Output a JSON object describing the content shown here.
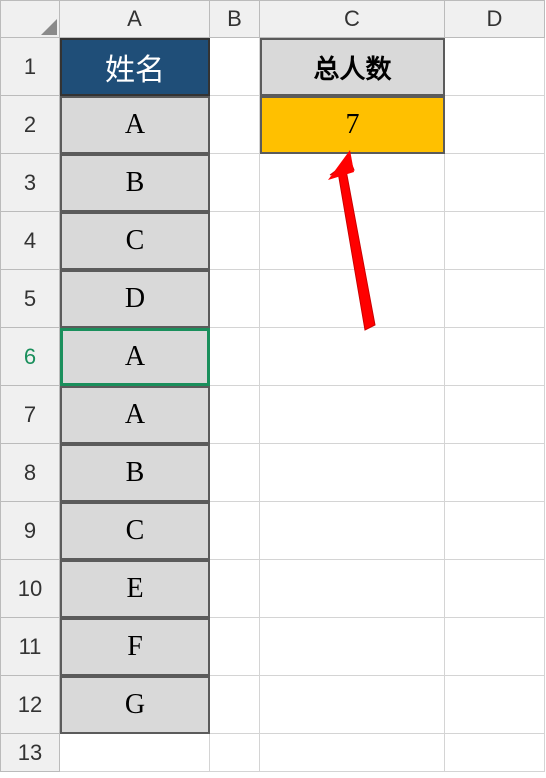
{
  "columns": [
    "A",
    "B",
    "C",
    "D"
  ],
  "rows": [
    "1",
    "2",
    "3",
    "4",
    "5",
    "6",
    "7",
    "8",
    "9",
    "10",
    "11",
    "12",
    "13"
  ],
  "selectedRow": "6",
  "columnA": {
    "header": "姓名",
    "values": [
      "A",
      "B",
      "C",
      "D",
      "A",
      "A",
      "B",
      "C",
      "E",
      "F",
      "G"
    ]
  },
  "columnC": {
    "header": "总人数",
    "value": "7"
  }
}
